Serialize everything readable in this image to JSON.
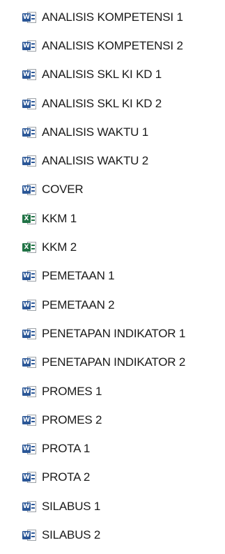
{
  "files": [
    {
      "name": "ANALISIS KOMPETENSI 1",
      "icon": "word-document-icon",
      "badge": "W"
    },
    {
      "name": "ANALISIS KOMPETENSI 2",
      "icon": "word-document-icon",
      "badge": "W"
    },
    {
      "name": "ANALISIS SKL KI KD 1",
      "icon": "word-document-icon",
      "badge": "W"
    },
    {
      "name": "ANALISIS SKL KI KD 2",
      "icon": "word-document-icon",
      "badge": "W"
    },
    {
      "name": "ANALISIS WAKTU 1",
      "icon": "word-document-icon",
      "badge": "W"
    },
    {
      "name": "ANALISIS WAKTU 2",
      "icon": "word-document-icon",
      "badge": "W"
    },
    {
      "name": "COVER",
      "icon": "word-document-icon",
      "badge": "W"
    },
    {
      "name": "KKM 1",
      "icon": "excel-spreadsheet-icon",
      "badge": "X"
    },
    {
      "name": "KKM 2",
      "icon": "excel-spreadsheet-icon",
      "badge": "X"
    },
    {
      "name": "PEMETAAN 1",
      "icon": "word-document-icon",
      "badge": "W"
    },
    {
      "name": "PEMETAAN 2",
      "icon": "word-document-icon",
      "badge": "W"
    },
    {
      "name": "PENETAPAN INDIKATOR 1",
      "icon": "word-document-icon",
      "badge": "W"
    },
    {
      "name": "PENETAPAN INDIKATOR 2",
      "icon": "word-document-icon",
      "badge": "W"
    },
    {
      "name": "PROMES 1",
      "icon": "word-document-icon",
      "badge": "W"
    },
    {
      "name": "PROMES 2",
      "icon": "word-document-icon",
      "badge": "W"
    },
    {
      "name": "PROTA 1",
      "icon": "word-document-icon",
      "badge": "W"
    },
    {
      "name": "PROTA 2",
      "icon": "word-document-icon",
      "badge": "W"
    },
    {
      "name": "SILABUS 1",
      "icon": "word-document-icon",
      "badge": "W"
    },
    {
      "name": "SILABUS 2",
      "icon": "word-document-icon",
      "badge": "W"
    }
  ],
  "colors": {
    "word": "#2b5797",
    "excel": "#217346",
    "text": "#1a1a1a",
    "background": "#ffffff"
  }
}
